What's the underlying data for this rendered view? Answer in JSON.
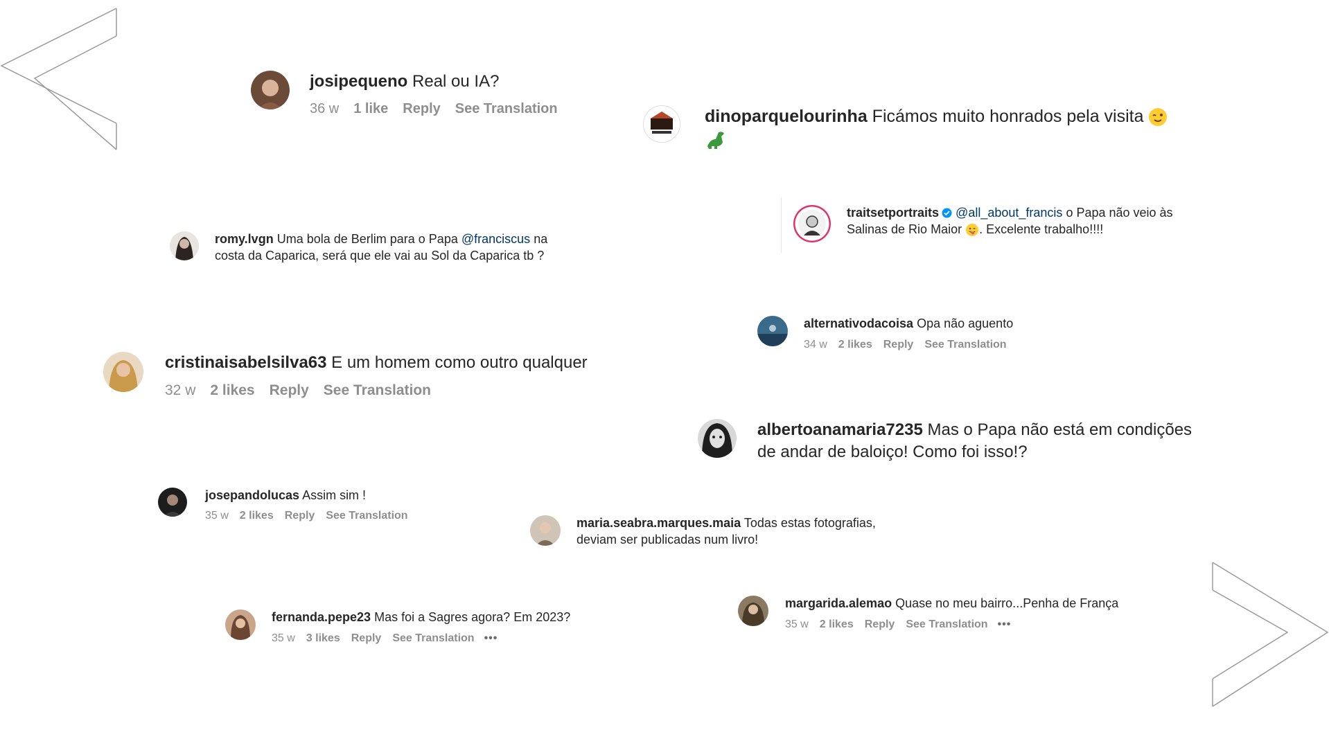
{
  "colors": {
    "username": "#262626",
    "meta": "#8e8e8e",
    "mention": "#00376b",
    "verified": "#0095f6",
    "chevron": "#9a9a9a"
  },
  "icons": {
    "left_chevron": "left-chevron-outline-icon",
    "right_chevron": "right-chevron-outline-icon",
    "verified": "verified-badge-icon",
    "more": "more-dots-icon"
  },
  "comments": [
    {
      "user": "josipequeno",
      "text": "Real ou IA?",
      "time": "36 w",
      "likes": "1 like",
      "reply": "Reply",
      "translate": "See Translation"
    },
    {
      "user": "dinoparquelourinha",
      "text": "Ficámos muito honrados pela visita",
      "emoji1": "winking-face-icon",
      "emoji2": "dinosaur-icon"
    },
    {
      "user": "romy.lvgn",
      "text_a": "Uma bola de Berlim para o Papa",
      "mention": "@franciscus",
      "text_b": "na",
      "text_c": "costa da Caparica, será que ele vai au Sol da Caparica tb ?"
    },
    {
      "user": "traitsetportraits",
      "mention": "@all_about_francis",
      "text_a": "o Papa não veio às",
      "text_b": "Salinas de Rio Maior",
      "text_c": ". Excelente trabalho!!!!"
    },
    {
      "user": "alternativodacoisa",
      "text": "Opa não aguento",
      "time": "34 w",
      "likes": "2 likes",
      "reply": "Reply",
      "translate": "See Translation"
    },
    {
      "user": "cristinaisabelsilva63",
      "text": "E um homem como outro qualquer",
      "time": "32 w",
      "likes": "2 likes",
      "reply": "Reply",
      "translate": "See Translation"
    },
    {
      "user": "albertoanamaria7235",
      "text_a": "Mas o Papa não está em condições",
      "text_b": "de andar de baloiço! Como foi isso!?"
    },
    {
      "user": "josepandolucas",
      "text": "Assim sim !",
      "time": "35 w",
      "likes": "2 likes",
      "reply": "Reply",
      "translate": "See Translation"
    },
    {
      "user": "maria.seabra.marques.maia",
      "text_a": "Todas estas fotografias,",
      "text_b": "deviam ser publicadas num livro!"
    },
    {
      "user": "fernanda.pepe23",
      "text": "Mas foi a Sagres agora? Em 2023?",
      "time": "35 w",
      "likes": "3 likes",
      "reply": "Reply",
      "translate": "See Translation",
      "more": "•••"
    },
    {
      "user": "margarida.alemao",
      "text": "Quase no meu bairro...Penha de França",
      "time": "35 w",
      "likes": "2 likes",
      "reply": "Reply",
      "translate": "See Translation",
      "more": "•••"
    }
  ]
}
